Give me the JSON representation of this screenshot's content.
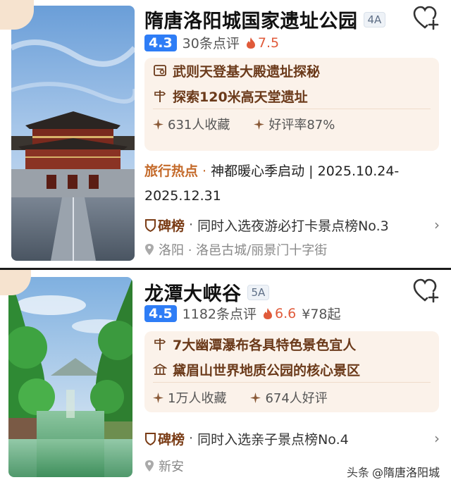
{
  "cards": [
    {
      "title": "隋唐洛阳城国家遗址公园",
      "level": "4A",
      "score": "4.3",
      "reviews": "30条点评",
      "heat": "7.5",
      "features": [
        "武则天登基大殿遗址探秘",
        "探索120米高天堂遗址"
      ],
      "feature_icons": [
        "ticket-icon",
        "sign-icon"
      ],
      "stats": [
        "631人收藏",
        "好评率87%"
      ],
      "event_tag": "旅行热点",
      "event_text": "神都暖心季启动 | 2025.10.24-2025.12.31",
      "rank_tag": "碑榜",
      "rank_text": "同时入选夜游必打卡景点榜No.3",
      "location": "洛阳 · 洛邑古城/丽景门十字街"
    },
    {
      "title": "龙潭大峡谷",
      "level": "5A",
      "score": "4.5",
      "reviews": "1182条点评",
      "heat": "6.6",
      "price": "¥78起",
      "features": [
        "7大幽潭瀑布各具特色景色宜人",
        "黛眉山世界地质公园的核心景区"
      ],
      "feature_icons": [
        "sign-icon",
        "landmark-icon"
      ],
      "stats": [
        "1万人收藏",
        "674人好评"
      ],
      "rank_tag": "碑榜",
      "rank_text": "同时入选亲子景点榜No.4",
      "location": "新安"
    }
  ],
  "watermark": {
    "platform": "头条",
    "handle": "@隋唐洛阳城"
  },
  "colors": {
    "score_bg": "#2e7df6",
    "feature_bg": "#fbf2ea",
    "feature_text": "#6b3a1a",
    "heat": "#e05a3a",
    "event_tag": "#c46a2a"
  }
}
